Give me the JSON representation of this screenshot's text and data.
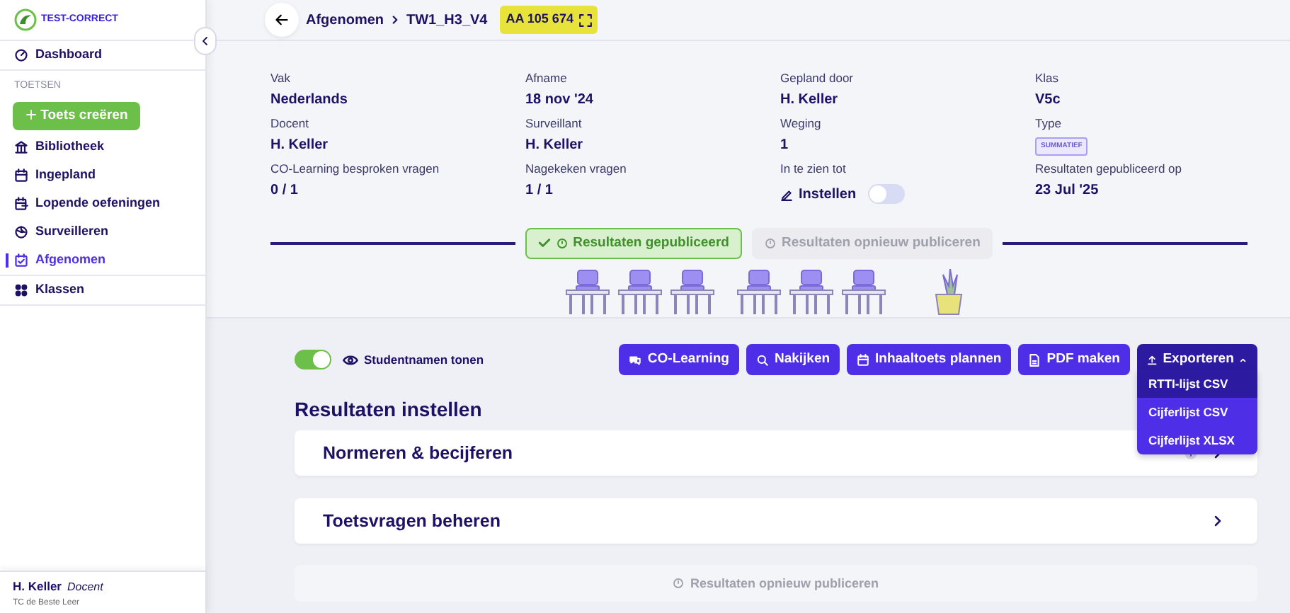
{
  "sidebar": {
    "logo": "TEST-CORRECT",
    "items": [
      {
        "kind": "link",
        "label": "Dashboard",
        "selected": false
      },
      {
        "kind": "heading",
        "label": "TOETSEN"
      },
      {
        "kind": "button",
        "label": "Toets creëren"
      },
      {
        "kind": "link",
        "label": "Bibliotheek",
        "selected": false
      },
      {
        "kind": "link",
        "label": "Ingepland",
        "selected": false
      },
      {
        "kind": "link",
        "label": "Lopende oefeningen",
        "selected": false
      },
      {
        "kind": "link",
        "label": "Surveilleren",
        "selected": false
      },
      {
        "kind": "link",
        "label": "Afgenomen",
        "selected": true
      },
      {
        "kind": "link",
        "label": "Klassen",
        "selected": false
      }
    ],
    "user": {
      "name": "H. Keller",
      "role": "Docent",
      "school": "TC de Beste Leer"
    }
  },
  "topbar": {
    "breadcrumb": [
      "Afgenomen",
      "TW1_H3_V4"
    ],
    "code": "AA 105 674"
  },
  "details": [
    {
      "label": "Vak",
      "value": "Nederlands",
      "kind": "text"
    },
    {
      "label": "Afname",
      "value": "18 nov '24",
      "kind": "text"
    },
    {
      "label": "Gepland door",
      "value": "H. Keller",
      "kind": "text"
    },
    {
      "label": "Klas",
      "value": "V5c",
      "kind": "text"
    },
    {
      "label": "Docent",
      "value": "H. Keller",
      "kind": "text"
    },
    {
      "label": "Surveillant",
      "value": "H. Keller",
      "kind": "text"
    },
    {
      "label": "Weging",
      "value": "1",
      "kind": "text"
    },
    {
      "label": "Type",
      "value": "SUMMATIEF",
      "kind": "badge"
    },
    {
      "label": "CO-Learning besproken vragen",
      "value": "0 / 1",
      "kind": "text"
    },
    {
      "label": "Nagekeken vragen",
      "value": "1 / 1",
      "kind": "text"
    },
    {
      "label": "In te zien tot",
      "value": "Instellen",
      "kind": "toggle",
      "on": false
    },
    {
      "label": "Resultaten gepubliceerd op",
      "value": "23 Jul '25",
      "kind": "text"
    }
  ],
  "publish": [
    {
      "label": "Resultaten gepubliceerd",
      "kind": "done",
      "disabled": false
    },
    {
      "label": "Resultaten opnieuw publiceren",
      "kind": "republish",
      "disabled": true
    }
  ],
  "student_names": {
    "label": "Studentnamen tonen",
    "on": true
  },
  "actions": [
    {
      "label": "CO-Learning"
    },
    {
      "label": "Nakijken"
    },
    {
      "label": "Inhaaltoets plannen"
    },
    {
      "label": "PDF maken"
    }
  ],
  "export": {
    "label": "Exporteren",
    "expanded": true,
    "items": [
      {
        "label": "RTTI-lijst CSV",
        "selected": true
      },
      {
        "label": "Cijferlijst CSV",
        "selected": false
      },
      {
        "label": "Cijferlijst XLSX",
        "selected": false
      }
    ]
  },
  "section_title": "Resultaten instellen",
  "cards": [
    {
      "title": "Normeren & becijferen",
      "info": true
    },
    {
      "title": "Toetsvragen beheren",
      "info": false
    }
  ],
  "bottom_button": {
    "label": "Resultaten opnieuw publiceren",
    "disabled": true
  }
}
